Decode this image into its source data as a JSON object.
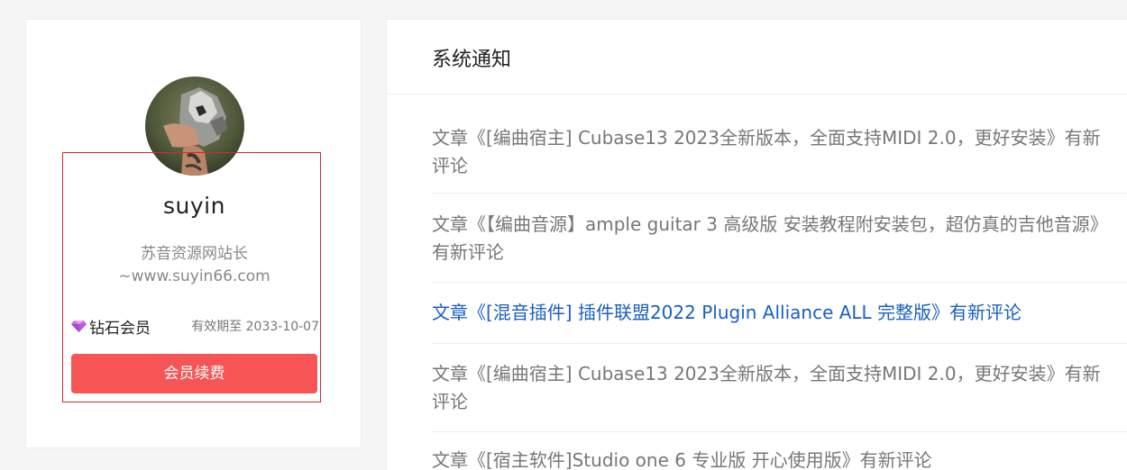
{
  "profile": {
    "username": "suyin",
    "bio_line1": "苏音资源网站长",
    "bio_line2": "~www.suyin66.com",
    "member_level": "钻石会员",
    "member_expiry": "有效期至 2033-10-07",
    "renew_button_label": "会员续费",
    "gem_icon": "gem-icon",
    "accent_color": "#f75555"
  },
  "notifications": {
    "title": "系统通知",
    "items": [
      {
        "text": "文章《[编曲宿主] Cubase13 2023全新版本，全面支持MIDI 2.0，更好安装》有新评论"
      },
      {
        "text": "文章《【编曲音源】ample guitar 3 高级版 安装教程附安装包，超仿真的吉他音源》有新评论"
      },
      {
        "text": "文章《[混音插件] 插件联盟2022 Plugin Alliance ALL 完整版》有新评论"
      },
      {
        "text": "文章《[编曲宿主] Cubase13 2023全新版本，全面支持MIDI 2.0，更好安装》有新评论"
      },
      {
        "text": "文章《[宿主软件]Studio one 6 专业版 开心使用版》有新评论"
      }
    ],
    "link_color": "#1a5fc4"
  }
}
